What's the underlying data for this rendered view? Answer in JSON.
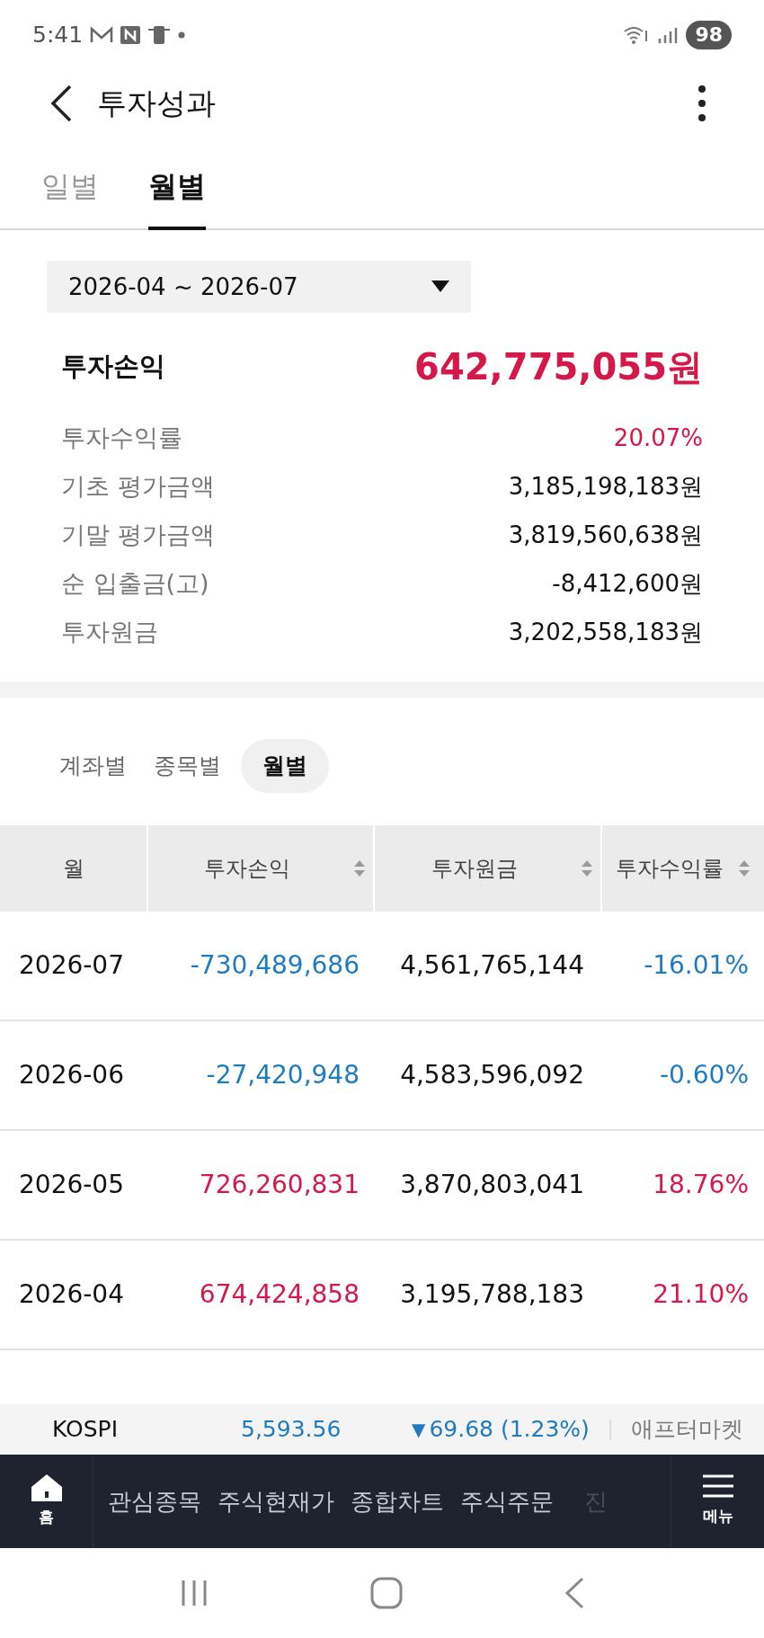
{
  "status_bar": {
    "time": "5:41",
    "battery": "98"
  },
  "header": {
    "title": "투자성과"
  },
  "tabs": [
    {
      "label": "일별",
      "selected": false
    },
    {
      "label": "월별",
      "selected": true
    }
  ],
  "period": {
    "value": "2026-04 ~ 2026-07"
  },
  "summary": {
    "label": "투자손익",
    "value": "642,775,055원",
    "color": "#d6174a"
  },
  "details": [
    {
      "label": "투자수익률",
      "value": "20.07%",
      "color": "#d6174a"
    },
    {
      "label": "기초 평가금액",
      "value": "3,185,198,183원",
      "color": "#111111"
    },
    {
      "label": "기말 평가금액",
      "value": "3,819,560,638원",
      "color": "#111111"
    },
    {
      "label": "순 입출금(고)",
      "value": "-8,412,600원",
      "color": "#111111"
    },
    {
      "label": "투자원금",
      "value": "3,202,558,183원",
      "color": "#111111"
    }
  ],
  "view_tabs": [
    {
      "label": "계좌별",
      "selected": false
    },
    {
      "label": "종목별",
      "selected": false
    },
    {
      "label": "월별",
      "selected": true
    }
  ],
  "table": {
    "columns": [
      {
        "label": "월",
        "sortable": false
      },
      {
        "label": "투자손익",
        "sortable": true
      },
      {
        "label": "투자원금",
        "sortable": true
      },
      {
        "label": "투자수익률",
        "sortable": true
      }
    ],
    "rows": [
      {
        "month": "2026-07",
        "profit": "-730,489,686",
        "principal": "4,561,765,144",
        "rate": "-16.01%",
        "color": "#1f7bc1"
      },
      {
        "month": "2026-06",
        "profit": "-27,420,948",
        "principal": "4,583,596,092",
        "rate": "-0.60%",
        "color": "#1f7bc1"
      },
      {
        "month": "2026-05",
        "profit": "726,260,831",
        "principal": "3,870,803,041",
        "rate": "18.76%",
        "color": "#d6174a"
      },
      {
        "month": "2026-04",
        "profit": "674,424,858",
        "principal": "3,195,788,183",
        "rate": "21.10%",
        "color": "#d6174a"
      }
    ]
  },
  "ticker": {
    "name": "KOSPI",
    "price": "5,593.56",
    "arrow": "▼",
    "change": "69.68 (1.23%)",
    "color": "#1f7bc1",
    "session": "애프터마켓"
  },
  "nav": {
    "home": "홈",
    "items": [
      {
        "label": "관심종목",
        "cut": false
      },
      {
        "label": "주식현재가",
        "cut": false
      },
      {
        "label": "종합차트",
        "cut": false
      },
      {
        "label": "주식주문",
        "cut": false
      },
      {
        "label": "진",
        "cut": true
      }
    ],
    "menu": "메뉴"
  }
}
